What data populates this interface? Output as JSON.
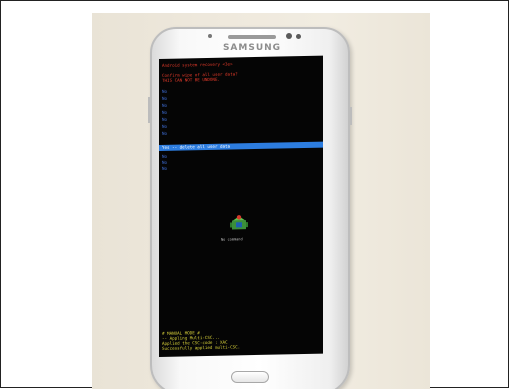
{
  "photo": {
    "brand": "SAMSUNG",
    "screen": {
      "title": "Android system recovery <3e>",
      "confirm_line": "Confirm wipe of all user data?",
      "warning_line": "THIS CAN NOT BE UNDONE.",
      "menu_no_items": [
        "No",
        "No",
        "No",
        "No",
        "No",
        "No",
        "No"
      ],
      "selected_item": "Yes -- delete all user data",
      "menu_after_items": [
        "No",
        "No",
        "No"
      ],
      "status_label": "No command",
      "log_lines": [
        "# MANUAL MODE #",
        "-- Appling Multi-CSC...",
        "Applied the CSC-code : XAC",
        "Successfully applied multi-CSC."
      ]
    }
  }
}
